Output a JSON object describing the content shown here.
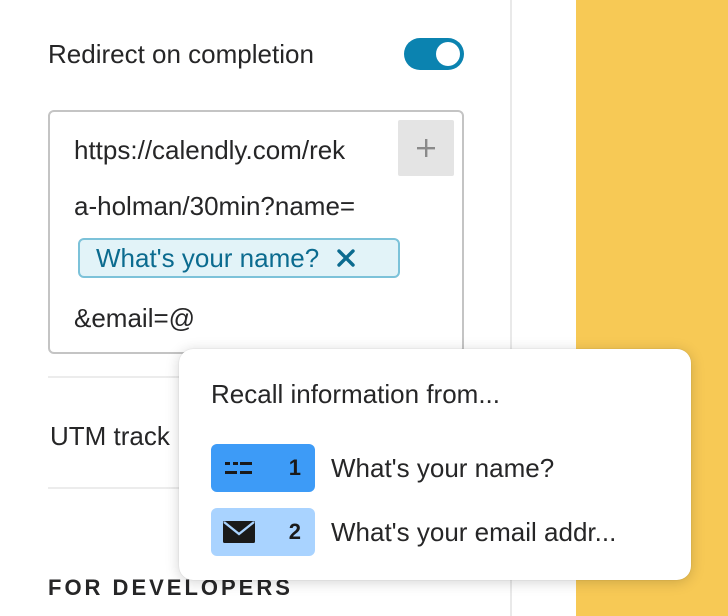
{
  "redirect": {
    "label": "Redirect on completion",
    "enabled": true
  },
  "url_editor": {
    "line1": "https://calendly.com/rek",
    "line2": "a-holman/30min?name=",
    "tag_label": "What's your name?",
    "line4": "&email=@"
  },
  "utm": {
    "label": "UTM track"
  },
  "developers": {
    "heading": "FOR DEVELOPERS"
  },
  "recall_popup": {
    "title": "Recall information from...",
    "items": [
      {
        "number": "1",
        "label": "What's your name?",
        "icon": "short-text-icon",
        "color": "#3d9bf7"
      },
      {
        "number": "2",
        "label": "What's your email addr...",
        "icon": "envelope-icon",
        "color": "#a9d3ff"
      }
    ]
  },
  "colors": {
    "toggle_on": "#0b83b0",
    "tag_bg": "#e2f3f8",
    "tag_text": "#0b6b8f",
    "preview_bg": "#f7c955"
  }
}
